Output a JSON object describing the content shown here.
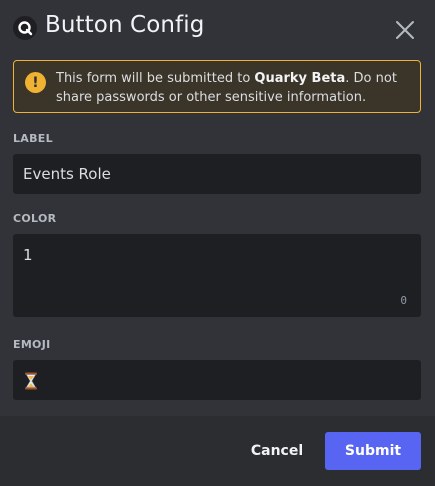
{
  "modal": {
    "title": "Button Config",
    "app_icon": "quarky-logo-icon",
    "close_icon": "close-icon"
  },
  "warning": {
    "icon": "exclamation-icon",
    "icon_glyph": "!",
    "text_before": "This form will be submitted to ",
    "app_name": "Quarky Beta",
    "text_after": ". Do not share passwords or other sensitive information."
  },
  "fields": {
    "label": {
      "label": "LABEL",
      "value": "Events Role"
    },
    "color": {
      "label": "COLOR",
      "value": "1",
      "char_count": "0"
    },
    "emoji": {
      "label": "EMOJI",
      "value_icon": "hourglass-icon"
    }
  },
  "footer": {
    "cancel_label": "Cancel",
    "submit_label": "Submit"
  },
  "colors": {
    "background": "#313338",
    "footer": "#2b2d31",
    "input": "#1e1f22",
    "warning_border": "#f0b232",
    "accent": "#5865f2"
  }
}
